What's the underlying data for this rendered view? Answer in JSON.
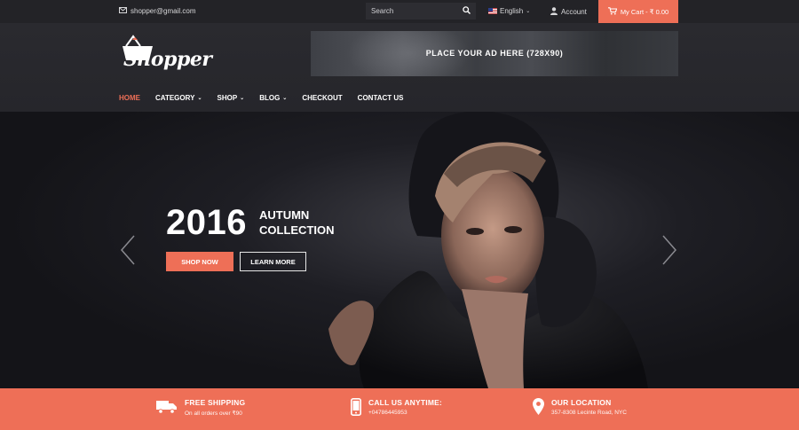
{
  "topbar": {
    "email": "shopper@gmail.com",
    "search_placeholder": "Search",
    "language": "English",
    "account_label": "Account",
    "cart_label": "My Cart - ₹ 0.00"
  },
  "header": {
    "logo_text": "Shopper",
    "ad_text": "PLACE YOUR AD HERE (728X90)"
  },
  "nav": {
    "items": [
      {
        "label": "HOME",
        "active": true
      },
      {
        "label": "CATEGORY"
      },
      {
        "label": "SHOP"
      },
      {
        "label": "BLOG"
      },
      {
        "label": "CHECKOUT"
      },
      {
        "label": "CONTACT US"
      }
    ]
  },
  "hero": {
    "year": "2016",
    "title_line1": "AUTUMN",
    "title_line2": "COLLECTION",
    "shop_now": "SHOP NOW",
    "learn_more": "LEARN MORE"
  },
  "features": [
    {
      "title": "FREE SHIPPING",
      "subtitle": "On all orders over ₹90",
      "icon": "truck-icon"
    },
    {
      "title": "CALL US ANYTIME:",
      "subtitle": "+04786445953",
      "icon": "phone-icon"
    },
    {
      "title": "OUR LOCATION",
      "subtitle": "357-8308 Lecinte Road, NYC",
      "icon": "map-pin-icon"
    }
  ],
  "colors": {
    "accent": "#ee6f57",
    "topbar_bg": "#232327",
    "header_bg": "#28282d"
  }
}
